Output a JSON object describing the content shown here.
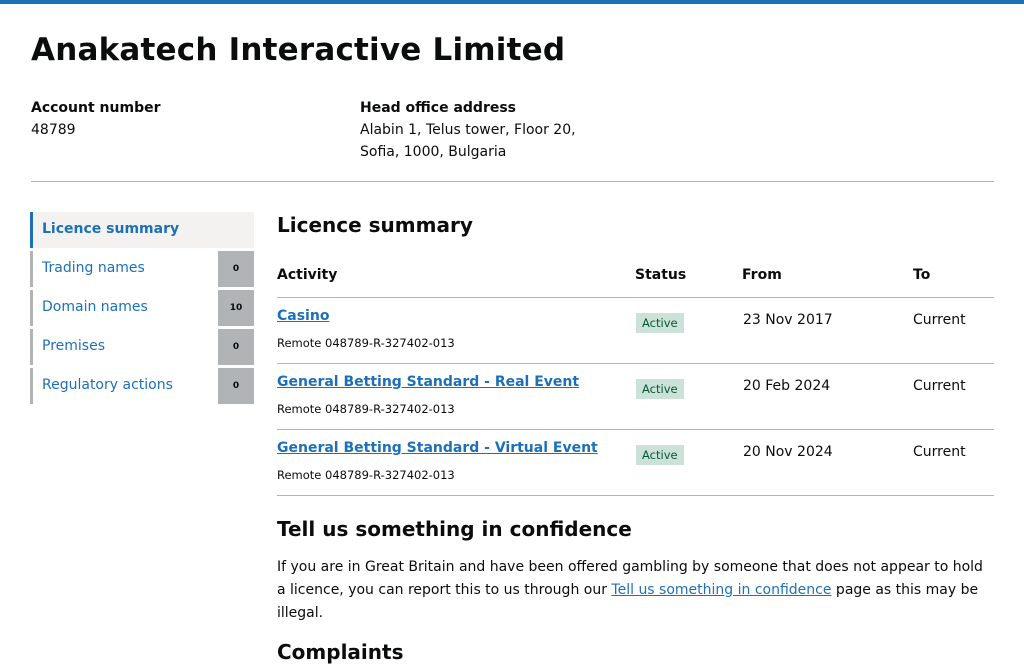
{
  "company": {
    "name": "Anakatech Interactive Limited"
  },
  "account": {
    "label": "Account number",
    "value": "48789"
  },
  "address": {
    "label": "Head office address",
    "line1": "Alabin 1, Telus tower, Floor 20,",
    "line2": "Sofia, 1000, Bulgaria"
  },
  "sidebar": {
    "items": [
      {
        "label": "Licence summary",
        "count": ""
      },
      {
        "label": "Trading names",
        "count": "0"
      },
      {
        "label": "Domain names",
        "count": "10"
      },
      {
        "label": "Premises",
        "count": "0"
      },
      {
        "label": "Regulatory actions",
        "count": "0"
      }
    ]
  },
  "summary": {
    "heading": "Licence summary",
    "columns": [
      "Activity",
      "Status",
      "From",
      "To"
    ],
    "rows": [
      {
        "activity": "Casino",
        "reference": "Remote 048789-R-327402-013",
        "status": "Active",
        "from": "23 Nov 2017",
        "to": "Current"
      },
      {
        "activity": "General Betting Standard - Real Event",
        "reference": "Remote 048789-R-327402-013",
        "status": "Active",
        "from": "20 Feb 2024",
        "to": "Current"
      },
      {
        "activity": "General Betting Standard - Virtual Event",
        "reference": "Remote 048789-R-327402-013",
        "status": "Active",
        "from": "20 Nov 2024",
        "to": "Current"
      }
    ]
  },
  "confidence": {
    "heading": "Tell us something in confidence",
    "text_before": "If you are in Great Britain and have been offered gambling by someone that does not appear to hold a licence, you can report this to us through our ",
    "link": "Tell us something in confidence",
    "text_after": " page as this may be illegal."
  },
  "complaints": {
    "heading": "Complaints"
  },
  "colors": {
    "accent": "#1d70b8",
    "badge_bg": "#cce2d8",
    "badge_text": "#005a30",
    "count_bg": "#b1b4b6"
  }
}
